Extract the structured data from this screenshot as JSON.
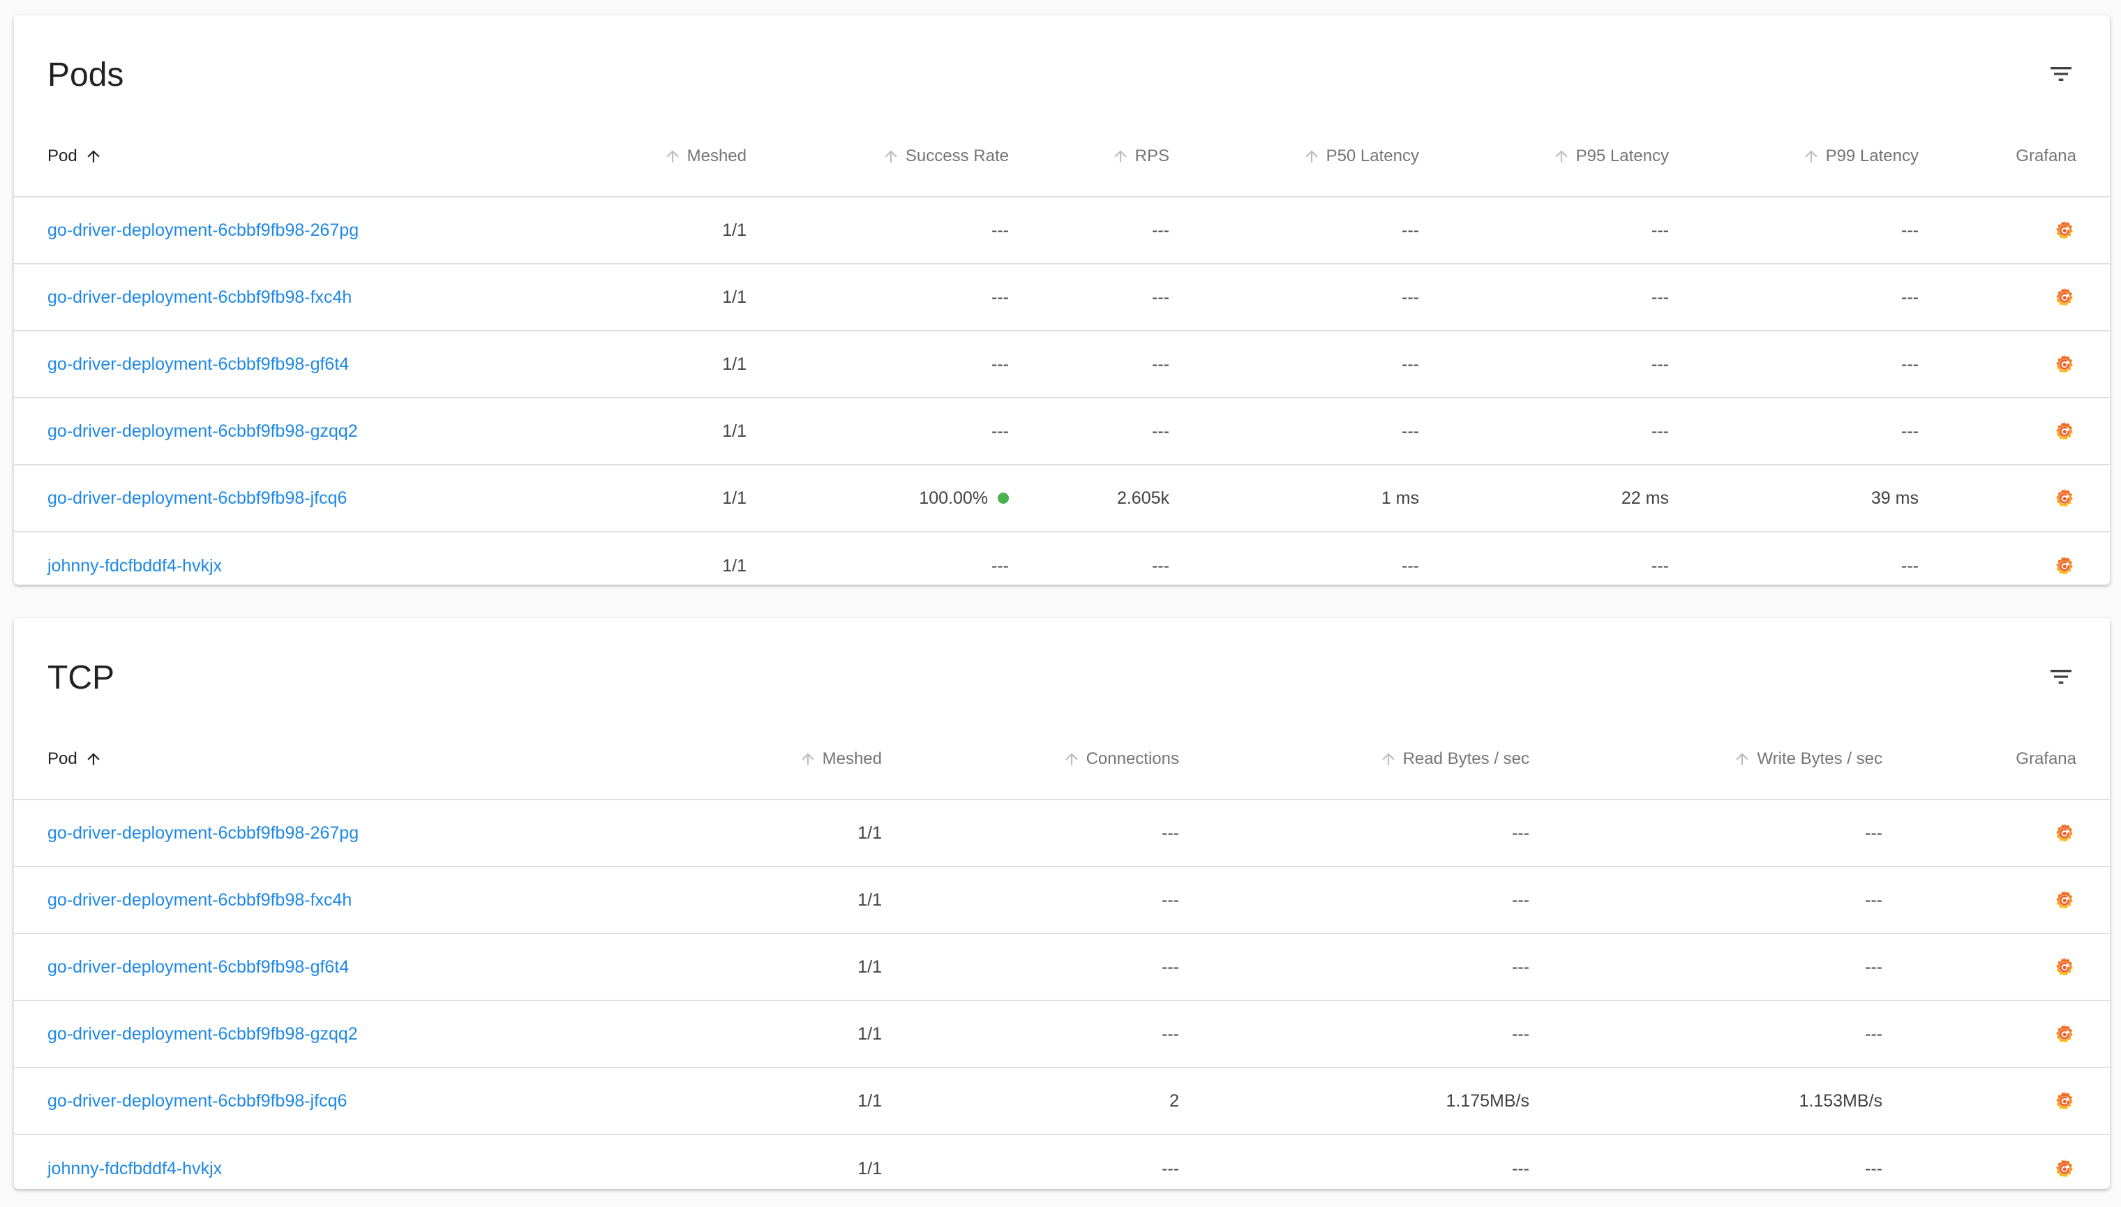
{
  "colors": {
    "link": "#1e88e5",
    "success_dot": "#4caf50",
    "grafana_icon": "#f46800"
  },
  "pods": {
    "title": "Pods",
    "filter_icon": "filter-list-icon",
    "columns": {
      "pod": "Pod",
      "meshed": "Meshed",
      "success_rate": "Success Rate",
      "rps": "RPS",
      "p50": "P50 Latency",
      "p95": "P95 Latency",
      "p99": "P99 Latency",
      "grafana": "Grafana"
    },
    "rows": [
      {
        "pod": "go-driver-deployment-6cbbf9fb98-267pg",
        "meshed": "1/1",
        "success_rate": "---",
        "rps": "---",
        "p50": "---",
        "p95": "---",
        "p99": "---"
      },
      {
        "pod": "go-driver-deployment-6cbbf9fb98-fxc4h",
        "meshed": "1/1",
        "success_rate": "---",
        "rps": "---",
        "p50": "---",
        "p95": "---",
        "p99": "---"
      },
      {
        "pod": "go-driver-deployment-6cbbf9fb98-gf6t4",
        "meshed": "1/1",
        "success_rate": "---",
        "rps": "---",
        "p50": "---",
        "p95": "---",
        "p99": "---"
      },
      {
        "pod": "go-driver-deployment-6cbbf9fb98-gzqq2",
        "meshed": "1/1",
        "success_rate": "---",
        "rps": "---",
        "p50": "---",
        "p95": "---",
        "p99": "---"
      },
      {
        "pod": "go-driver-deployment-6cbbf9fb98-jfcq6",
        "meshed": "1/1",
        "success_rate": "100.00%",
        "rps": "2.605k",
        "p50": "1 ms",
        "p95": "22 ms",
        "p99": "39 ms"
      },
      {
        "pod": "johnny-fdcfbddf4-hvkjx",
        "meshed": "1/1",
        "success_rate": "---",
        "rps": "---",
        "p50": "---",
        "p95": "---",
        "p99": "---"
      }
    ]
  },
  "tcp": {
    "title": "TCP",
    "filter_icon": "filter-list-icon",
    "columns": {
      "pod": "Pod",
      "meshed": "Meshed",
      "connections": "Connections",
      "read": "Read Bytes / sec",
      "write": "Write Bytes / sec",
      "grafana": "Grafana"
    },
    "rows": [
      {
        "pod": "go-driver-deployment-6cbbf9fb98-267pg",
        "meshed": "1/1",
        "connections": "---",
        "read": "---",
        "write": "---"
      },
      {
        "pod": "go-driver-deployment-6cbbf9fb98-fxc4h",
        "meshed": "1/1",
        "connections": "---",
        "read": "---",
        "write": "---"
      },
      {
        "pod": "go-driver-deployment-6cbbf9fb98-gf6t4",
        "meshed": "1/1",
        "connections": "---",
        "read": "---",
        "write": "---"
      },
      {
        "pod": "go-driver-deployment-6cbbf9fb98-gzqq2",
        "meshed": "1/1",
        "connections": "---",
        "read": "---",
        "write": "---"
      },
      {
        "pod": "go-driver-deployment-6cbbf9fb98-jfcq6",
        "meshed": "1/1",
        "connections": "2",
        "read": "1.175MB/s",
        "write": "1.153MB/s"
      },
      {
        "pod": "johnny-fdcfbddf4-hvkjx",
        "meshed": "1/1",
        "connections": "---",
        "read": "---",
        "write": "---"
      }
    ]
  }
}
